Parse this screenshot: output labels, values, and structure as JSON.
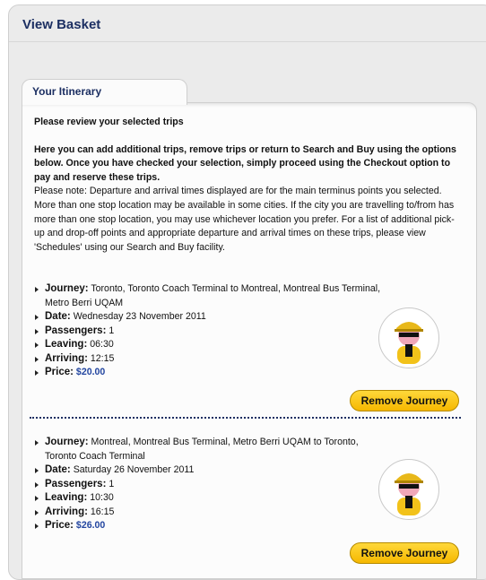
{
  "header": {
    "title": "View Basket"
  },
  "itinerary": {
    "tab_label": "Your Itinerary",
    "heading": "Please review your selected trips",
    "intro": "Here you can add additional trips, remove trips or return to Search and Buy using the options below. Once you have checked your selection, simply proceed using the Checkout option to pay and reserve these trips.",
    "note": "Please note: Departure and arrival times displayed are for the main terminus points you selected. More than one stop location may be available in some cities. If the city you are travelling to/from has more than one stop location, you may use whichever location you prefer. For a list of additional pick-up and drop-off points and appropriate departure and arrival times on these trips, please view 'Schedules' using our Search and Buy facility."
  },
  "labels": {
    "journey": "Journey:",
    "date": "Date:",
    "passengers": "Passengers:",
    "leaving": "Leaving:",
    "arriving": "Arriving:",
    "price": "Price:"
  },
  "journeys": [
    {
      "journey": "Toronto, Toronto Coach Terminal to Montreal, Montreal Bus Terminal, Metro Berri UQAM",
      "date": "Wednesday 23 November 2011",
      "passengers": "1",
      "leaving": "06:30",
      "arriving": "12:15",
      "price": "$20.00",
      "button": "Remove Journey"
    },
    {
      "journey": "Montreal, Montreal Bus Terminal, Metro Berri UQAM to Toronto, Toronto Coach Terminal",
      "date": "Saturday 26 November 2011",
      "passengers": "1",
      "leaving": "10:30",
      "arriving": "16:15",
      "price": "$26.00",
      "button": "Remove Journey"
    }
  ],
  "colors": {
    "brand_navy": "#1c2f62",
    "price_blue": "#2346a0",
    "button_yellow": "#f6b800"
  }
}
